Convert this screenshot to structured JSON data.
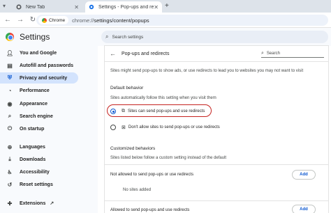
{
  "browser": {
    "tabs": [
      {
        "title": "New Tab",
        "active": false
      },
      {
        "title": "Settings - Pop-ups and redirect",
        "active": true
      }
    ],
    "omnibox": {
      "chip": "Chrome",
      "scheme": "chrome://",
      "path": "settings/content/popups"
    }
  },
  "header": {
    "title": "Settings",
    "search_placeholder": "Search settings"
  },
  "sidebar": {
    "items": [
      {
        "label": "You and Google",
        "icon": "person-icon"
      },
      {
        "label": "Autofill and passwords",
        "icon": "clipboard-icon"
      },
      {
        "label": "Privacy and security",
        "icon": "shield-icon",
        "selected": true
      },
      {
        "label": "Performance",
        "icon": "speedometer-icon"
      },
      {
        "label": "Appearance",
        "icon": "palette-icon"
      },
      {
        "label": "Search engine",
        "icon": "search-icon"
      },
      {
        "label": "On startup",
        "icon": "power-icon"
      },
      {
        "label": "Languages",
        "icon": "globe-icon"
      },
      {
        "label": "Downloads",
        "icon": "download-icon"
      },
      {
        "label": "Accessibility",
        "icon": "accessibility-icon"
      },
      {
        "label": "Reset settings",
        "icon": "reset-icon"
      },
      {
        "label": "Extensions",
        "icon": "puzzle-icon"
      }
    ]
  },
  "content": {
    "title": "Pop-ups and redirects",
    "search_placeholder": "Search",
    "description": "Sites might send pop-ups to show ads, or use redirects to lead you to websites you may not want to visit",
    "default_behavior": {
      "heading": "Default behavior",
      "subtext": "Sites automatically follow this setting when you visit them",
      "options": [
        {
          "label": "Sites can send pop-ups and use redirects",
          "selected": true
        },
        {
          "label": "Don't allow sites to send pop-ups or use redirects",
          "selected": false
        }
      ]
    },
    "customized": {
      "heading": "Customized behaviors",
      "subtext": "Sites listed below follow a custom setting instead of the default",
      "not_allowed_label": "Not allowed to send pop-ups or use redirects",
      "no_sites": "No sites added",
      "allowed_label": "Allowed to send pop-ups and use redirects",
      "add_label": "Add"
    }
  },
  "colors": {
    "accent": "#0b57d0",
    "highlight": "#c5221f",
    "selected_nav": "#d3e3fd"
  }
}
